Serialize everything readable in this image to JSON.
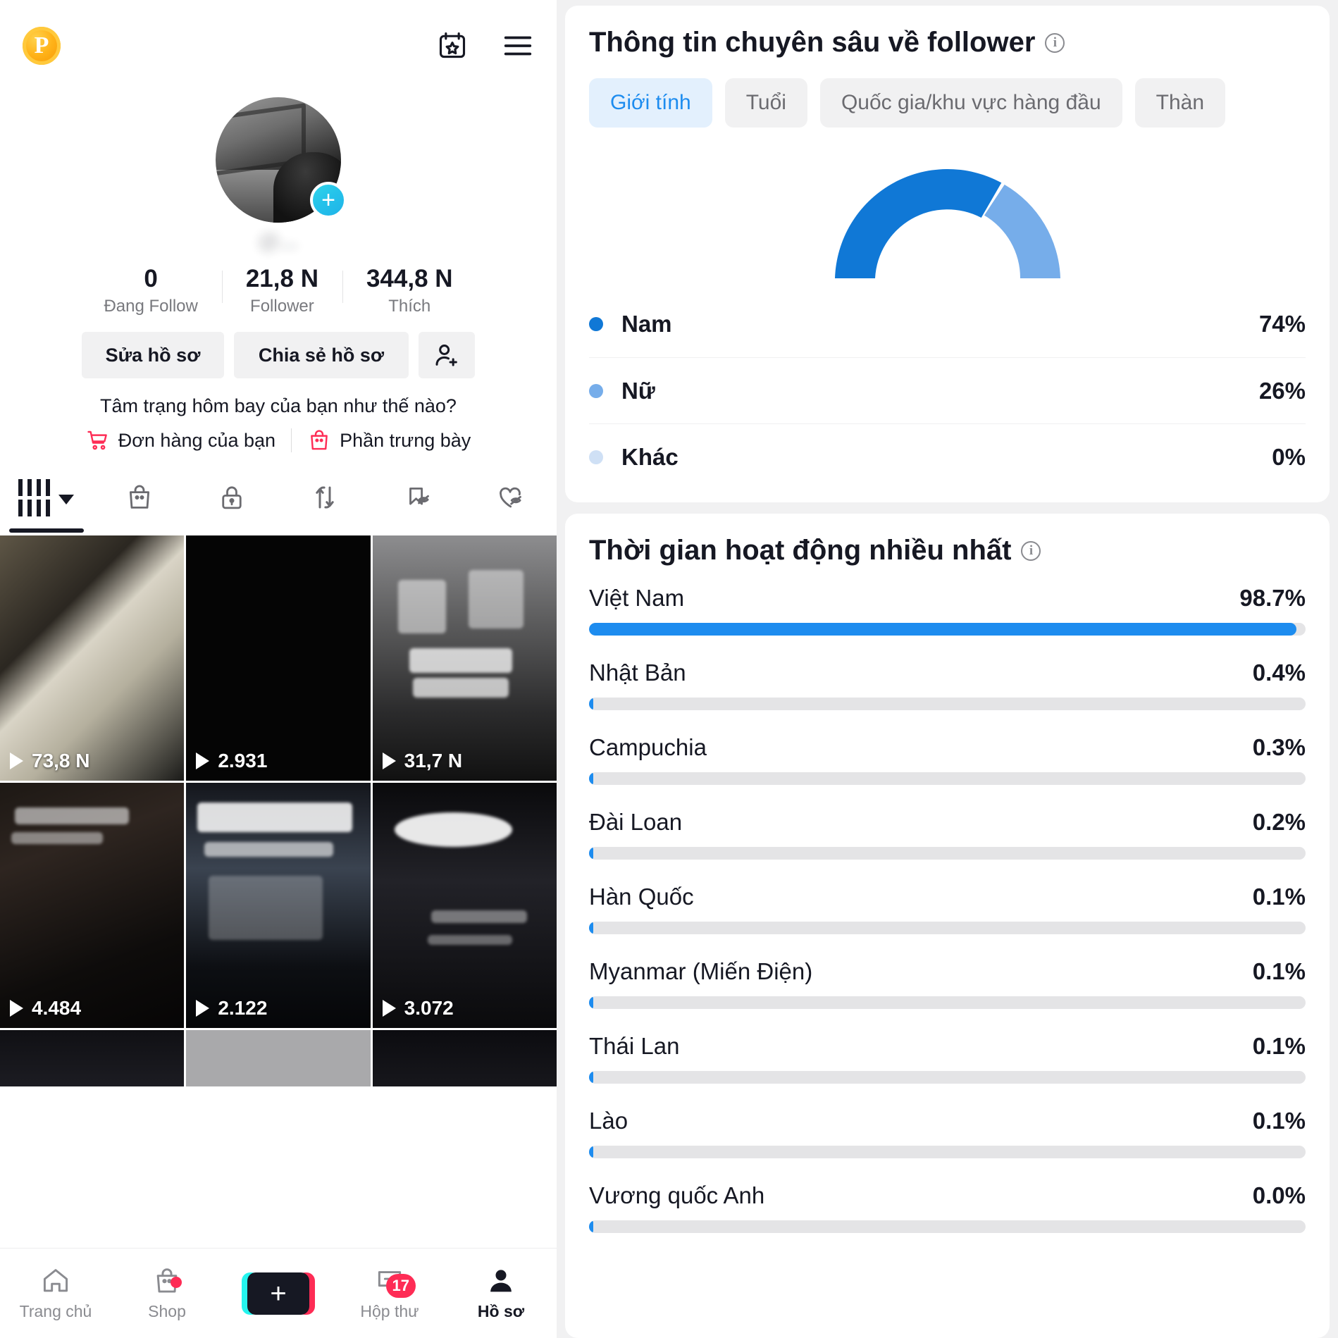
{
  "profile": {
    "coin_label": "P",
    "icons": {
      "calendar_star": "calendar-star-icon",
      "menu": "hamburger-menu-icon",
      "add_friend": "add-person-icon"
    },
    "handle": "@...",
    "avatar_plus": "+",
    "stats": [
      {
        "num": "0",
        "label": "Đang Follow"
      },
      {
        "num": "21,8 N",
        "label": "Follower"
      },
      {
        "num": "344,8 N",
        "label": "Thích"
      }
    ],
    "buttons": {
      "edit": "Sửa hồ sơ",
      "share": "Chia sẻ hồ sơ"
    },
    "mood_prompt": "Tâm trạng hôm bay của bạn như thế nào?",
    "shop_links": [
      {
        "label": "Đơn hàng của bạn",
        "icon": "shopping-cart-icon"
      },
      {
        "label": "Phần trưng bày",
        "icon": "shopping-bag-icon"
      }
    ],
    "tabs": [
      {
        "name": "grid-posts-tab",
        "icon": "grid-bars-icon",
        "active": true
      },
      {
        "name": "shop-tab",
        "icon": "shopping-bag-icon",
        "active": false
      },
      {
        "name": "private-tab",
        "icon": "lock-icon",
        "active": false
      },
      {
        "name": "repost-tab",
        "icon": "repost-arrows-icon",
        "active": false
      },
      {
        "name": "saved-hidden-tab",
        "icon": "bookmark-hidden-icon",
        "active": false
      },
      {
        "name": "liked-hidden-tab",
        "icon": "heart-hidden-icon",
        "active": false
      }
    ],
    "videos": [
      {
        "views": "73,8 N"
      },
      {
        "views": "2.931"
      },
      {
        "views": "31,7 N"
      },
      {
        "views": "4.484"
      },
      {
        "views": "2.122"
      },
      {
        "views": "3.072"
      }
    ],
    "nav": [
      {
        "label": "Trang chủ",
        "icon": "home-icon",
        "active": false,
        "badge": null
      },
      {
        "label": "Shop",
        "icon": "shopping-bag-icon",
        "active": false,
        "badge": "dot"
      },
      {
        "label": "",
        "icon": "create-plus-icon",
        "active": false,
        "badge": null
      },
      {
        "label": "Hộp thư",
        "icon": "inbox-message-icon",
        "active": false,
        "badge": "17"
      },
      {
        "label": "Hồ sơ",
        "icon": "person-icon",
        "active": true,
        "badge": null
      }
    ]
  },
  "analytics": {
    "follower_card": {
      "title": "Thông tin chuyên sâu về follower",
      "info_icon": "info-icon",
      "chips": [
        {
          "label": "Giới tính",
          "active": true
        },
        {
          "label": "Tuổi",
          "active": false
        },
        {
          "label": "Quốc gia/khu vực hàng đầu",
          "active": false
        },
        {
          "label": "Thàn",
          "active": false
        }
      ]
    },
    "activity_card": {
      "title": "Thời gian hoạt động nhiều nhất",
      "info_icon": "info-icon"
    }
  },
  "chart_data": [
    {
      "type": "pie",
      "title": "Giới tính",
      "labels": [
        "Nam",
        "Nữ",
        "Khác"
      ],
      "values": [
        74,
        26,
        0
      ],
      "value_labels": [
        "74%",
        "26%",
        "0%"
      ],
      "colors": [
        "#1078d6",
        "#76adea",
        "#cfe0f5"
      ],
      "legend": "bottom",
      "note": "semi-circular donut gauge"
    },
    {
      "type": "bar",
      "title": "Thời gian hoạt động nhiều nhất",
      "orientation": "horizontal",
      "categories": [
        "Việt Nam",
        "Nhật Bản",
        "Campuchia",
        "Đài Loan",
        "Hàn Quốc",
        "Myanmar (Miến Điện)",
        "Thái Lan",
        "Lào",
        "Vương quốc Anh"
      ],
      "values": [
        98.7,
        0.4,
        0.3,
        0.2,
        0.1,
        0.1,
        0.1,
        0.1,
        0.0
      ],
      "value_labels": [
        "98.7%",
        "0.4%",
        "0.3%",
        "0.2%",
        "0.1%",
        "0.1%",
        "0.1%",
        "0.1%",
        "0.0%"
      ],
      "xlim": [
        0,
        100
      ],
      "xlabel": "",
      "ylabel": "",
      "grid": false,
      "bar_color": "#1d8cef",
      "track_color": "#e4e4e6"
    }
  ]
}
